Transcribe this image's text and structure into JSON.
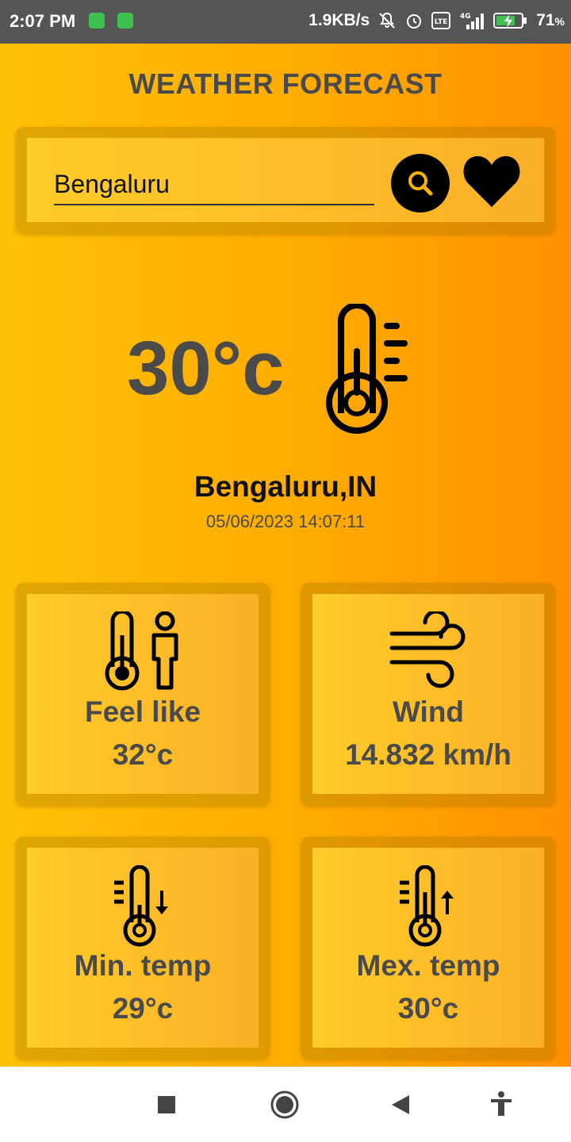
{
  "status_bar": {
    "time": "2:07 PM",
    "network_speed": "1.9KB/s",
    "network_type": "4G",
    "volte": "VoLTE",
    "battery": "71",
    "battery_unit": "%",
    "icons": [
      "notification-app-icon",
      "notification-app-icon",
      "mute-icon",
      "alarm-icon",
      "volte-icon",
      "signal-icon",
      "battery-charging-icon"
    ]
  },
  "app": {
    "title": "WEATHER FORECAST",
    "search": {
      "value": "Bengaluru",
      "search_icon": "search-icon",
      "favorite_icon": "heart-icon"
    },
    "current": {
      "temperature": "30°c",
      "icon": "thermometer-icon",
      "location": "Bengaluru,IN",
      "datetime": "05/06/2023 14:07:11"
    },
    "tiles": [
      {
        "icon": "feels-like-icon",
        "label": "Feel like",
        "value": "32°c"
      },
      {
        "icon": "wind-icon",
        "label": "Wind",
        "value": "14.832 km/h"
      },
      {
        "icon": "thermometer-down-icon",
        "label": "Min. temp",
        "value": "29°c"
      },
      {
        "icon": "thermometer-up-icon",
        "label": "Mex. temp",
        "value": "30°c"
      }
    ],
    "colors": {
      "gradient_start": "#ffc107",
      "gradient_end": "#ff9100",
      "text_dark": "#4a4a4a",
      "status_bar": "#555555"
    }
  },
  "nav_bar": {
    "buttons": [
      "recents-square-icon",
      "home-circle-icon",
      "back-triangle-icon",
      "accessibility-icon"
    ]
  }
}
